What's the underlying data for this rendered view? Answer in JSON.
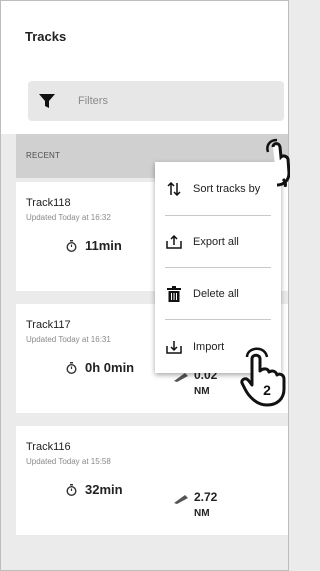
{
  "header": {
    "title": "Tracks"
  },
  "filter": {
    "placeholder": "Filters",
    "icon": "filter-icon"
  },
  "section": {
    "label": "RECENT"
  },
  "tracks": [
    {
      "name": "Track118",
      "updated": "Updated Today at 16:32",
      "duration": "11min",
      "distance": "",
      "unit": ""
    },
    {
      "name": "Track117",
      "updated": "Updated Today at 16:31",
      "duration": "0h 0min",
      "distance": "0.02",
      "unit": "NM"
    },
    {
      "name": "Track116",
      "updated": "Updated Today at 15:58",
      "duration": "32min",
      "distance": "2.72",
      "unit": "NM"
    }
  ],
  "menu": {
    "items": [
      {
        "label": "Sort tracks by",
        "icon": "sort-icon"
      },
      {
        "label": "Export all",
        "icon": "export-icon"
      },
      {
        "label": "Delete all",
        "icon": "trash-icon"
      },
      {
        "label": "Import",
        "icon": "import-icon"
      }
    ]
  },
  "annotation": {
    "step": "2"
  }
}
